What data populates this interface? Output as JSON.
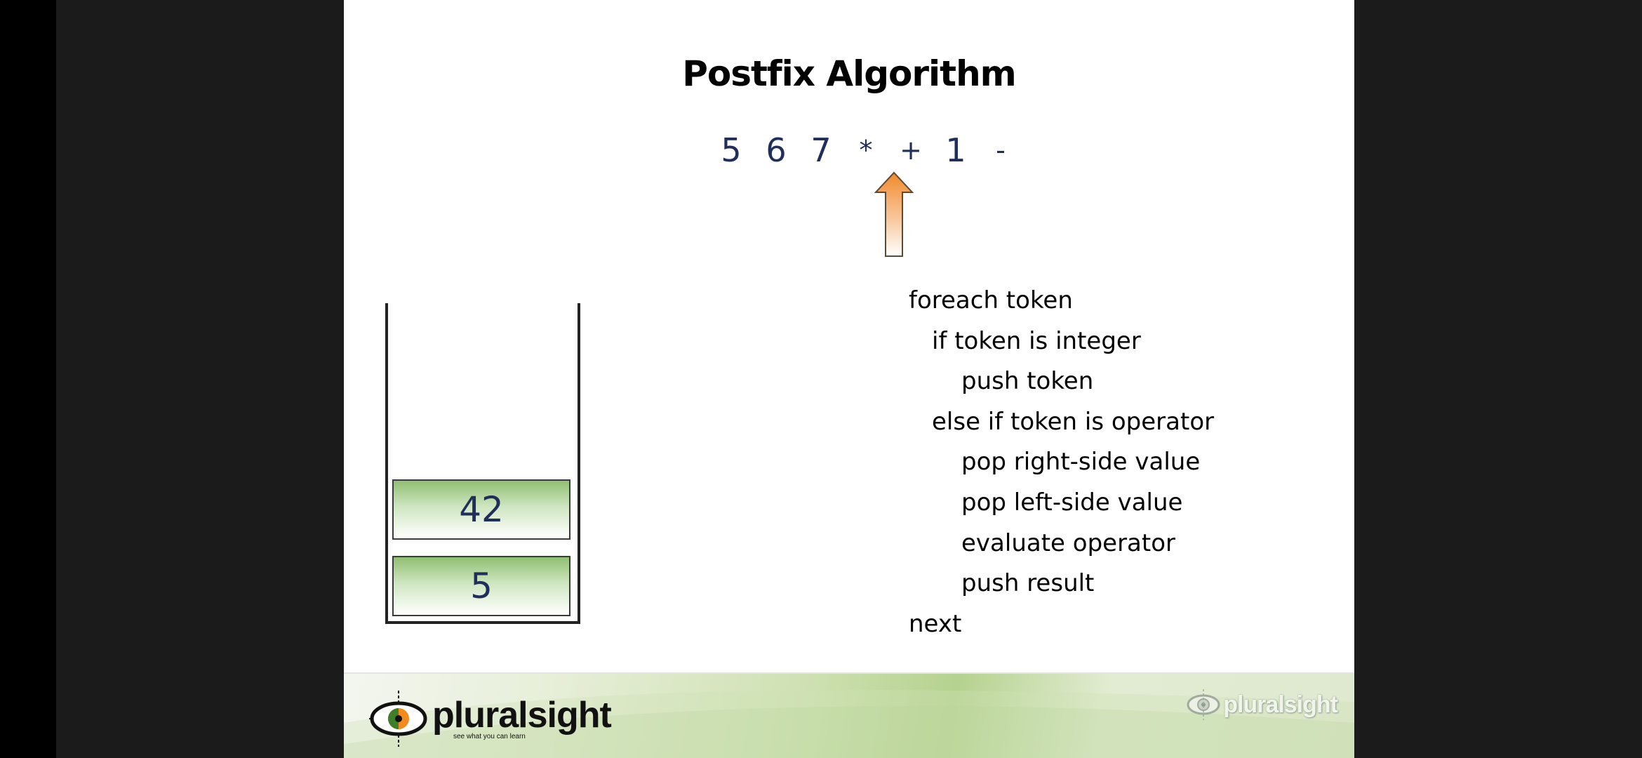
{
  "slide": {
    "title": "Postfix Algorithm",
    "tokens": [
      "5",
      "6",
      "7",
      "*",
      "+",
      "1",
      "-"
    ],
    "current_token_index": 4,
    "stack_items": [
      "42",
      "5"
    ],
    "pseudocode": [
      {
        "text": "foreach token",
        "indent": 0
      },
      {
        "text": "if token is integer",
        "indent": 1
      },
      {
        "text": "push token",
        "indent": 2
      },
      {
        "text": "else if token is operator",
        "indent": 1
      },
      {
        "text": "pop right-side value",
        "indent": 2
      },
      {
        "text": "pop left-side value",
        "indent": 2
      },
      {
        "text": "evaluate operator",
        "indent": 2
      },
      {
        "text": "push result",
        "indent": 2
      },
      {
        "text": "next",
        "indent": 0
      }
    ]
  },
  "footer": {
    "logo_text": "pluralsight",
    "tagline": "see what you can learn",
    "watermark_text": "pluralsight"
  },
  "colors": {
    "token_color": "#1f2e5a",
    "arrow_top": "#f08a2c",
    "stack_green": "#8fbf72",
    "bezel": "#1b1b1b"
  }
}
